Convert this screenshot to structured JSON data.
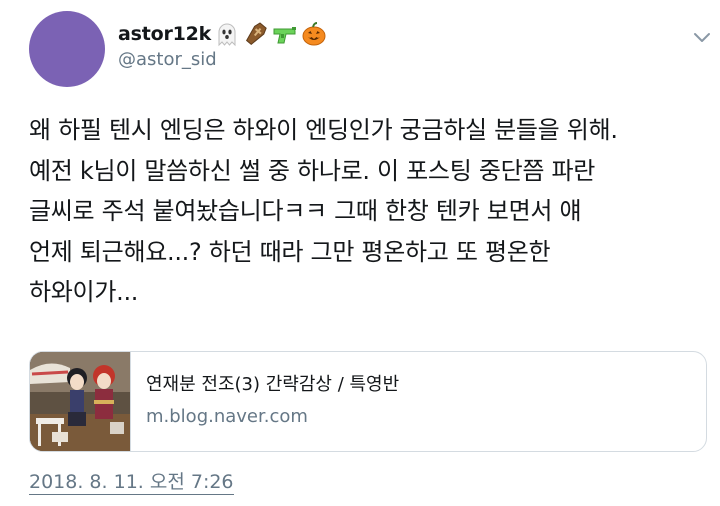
{
  "author": {
    "display_name": "astor12k",
    "handle": "@astor_sid",
    "name_emojis": [
      "ghost-emoji",
      "coffin-emoji",
      "water-pistol-emoji",
      "jack-o-lantern-emoji"
    ],
    "avatar_color": "#7b62b4"
  },
  "tweet": {
    "lines": [
      "왜 하필 텐시 엔딩은 하와이 엔딩인가 궁금하실 분들을 위해.",
      "예전 k님이 말씀하신 썰 중 하나로. 이 포스팅 중단쯤 파란",
      "글씨로 주석 붙여놨습니다ㅋㅋ 그때 한창 텐카 보면서 얘",
      "언제 퇴근해요...? 하던 때라 그만 평온하고 또 평온한",
      "하와이가..."
    ]
  },
  "link_card": {
    "title": "연재분 전조(3) 간략감상 / 특영반",
    "domain": "m.blog.naver.com",
    "thumbnail_icon": "doll-photo-thumbnail"
  },
  "timestamp": "2018. 8. 11. 오전 7:26",
  "menu_icon": "chevron-down-icon",
  "colors": {
    "text": "#14171a",
    "secondary": "#657786",
    "border": "#d4dbe1"
  }
}
